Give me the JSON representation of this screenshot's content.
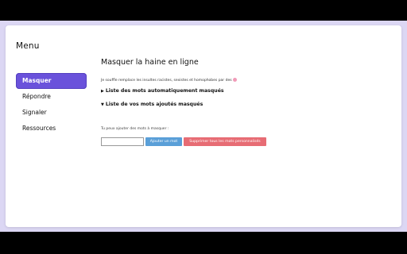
{
  "sidebar": {
    "title": "Menu",
    "items": [
      {
        "label": "Masquer",
        "active": true
      },
      {
        "label": "Répondre",
        "active": false
      },
      {
        "label": "Signaler",
        "active": false
      },
      {
        "label": "Ressources",
        "active": false
      }
    ]
  },
  "main": {
    "title": "Masquer la haine en ligne",
    "description": "Je souffle remplace les insultes racistes, sexistes et homophobes par des",
    "sections": [
      {
        "label": "Liste des mots automatiquement masqués",
        "expanded": false
      },
      {
        "label": "Liste de vos mots ajoutés masqués",
        "expanded": true
      }
    ],
    "hint": "Tu peux ajouter des mots à masquer :",
    "input": {
      "value": "",
      "placeholder": ""
    },
    "add_button": "Ajouter un mot",
    "delete_button": "Supprimer tous les mots personnalisés"
  },
  "colors": {
    "accent": "#6a52db",
    "add_button": "#5a9fd8",
    "delete_button": "#e76c74",
    "background": "#dcd7f4"
  }
}
